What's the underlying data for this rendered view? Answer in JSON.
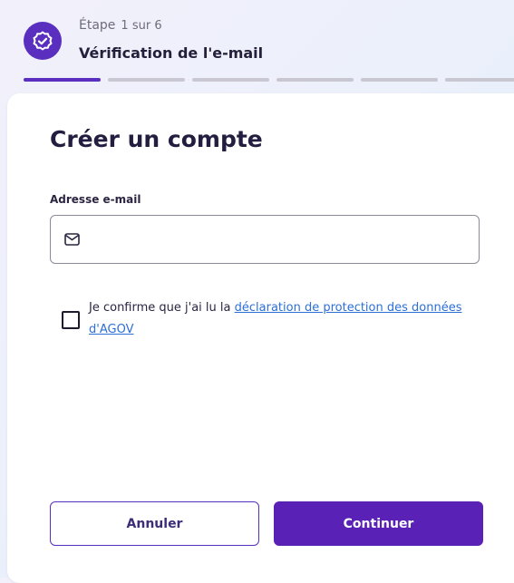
{
  "step": {
    "label": "Étape",
    "counter": "1 sur 6",
    "title": "Vérification de l'e-mail",
    "current": 1,
    "total": 6,
    "badge_icon": "check-badge-icon"
  },
  "form": {
    "title": "Créer un compte",
    "email_label": "Adresse e-mail",
    "email_value": "",
    "email_icon": "mail-icon"
  },
  "consent": {
    "text_before": "Je confirme que j'ai lu la ",
    "link_text": "déclaration de protection des données d'AGOV",
    "checked": false
  },
  "actions": {
    "cancel_label": "Annuler",
    "continue_label": "Continuer"
  },
  "colors": {
    "accent": "#5a2fbf",
    "link": "#2c6fd6",
    "progress_inactive": "#c9c8d2"
  }
}
